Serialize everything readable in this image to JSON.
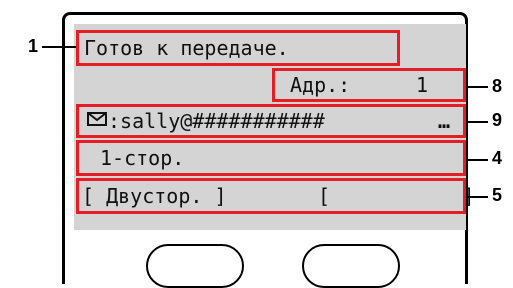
{
  "display": {
    "status_text": "Готов к передаче.",
    "address_label": "Адр.:",
    "address_value": "1",
    "destination_icon": "envelope-icon",
    "destination_text": ":sally@###########",
    "destination_ellipsis": "…",
    "duplex_mode": "1-стор.",
    "softkey_left_label": "[ Двустор. ]",
    "softkey_right_label": "[           ]"
  },
  "callouts": {
    "status": "1",
    "address": "8",
    "destination": "9",
    "mode": "4",
    "softkeys": "5"
  },
  "colors": {
    "highlight": "#e31e24",
    "screen": "#d4d4d4"
  }
}
